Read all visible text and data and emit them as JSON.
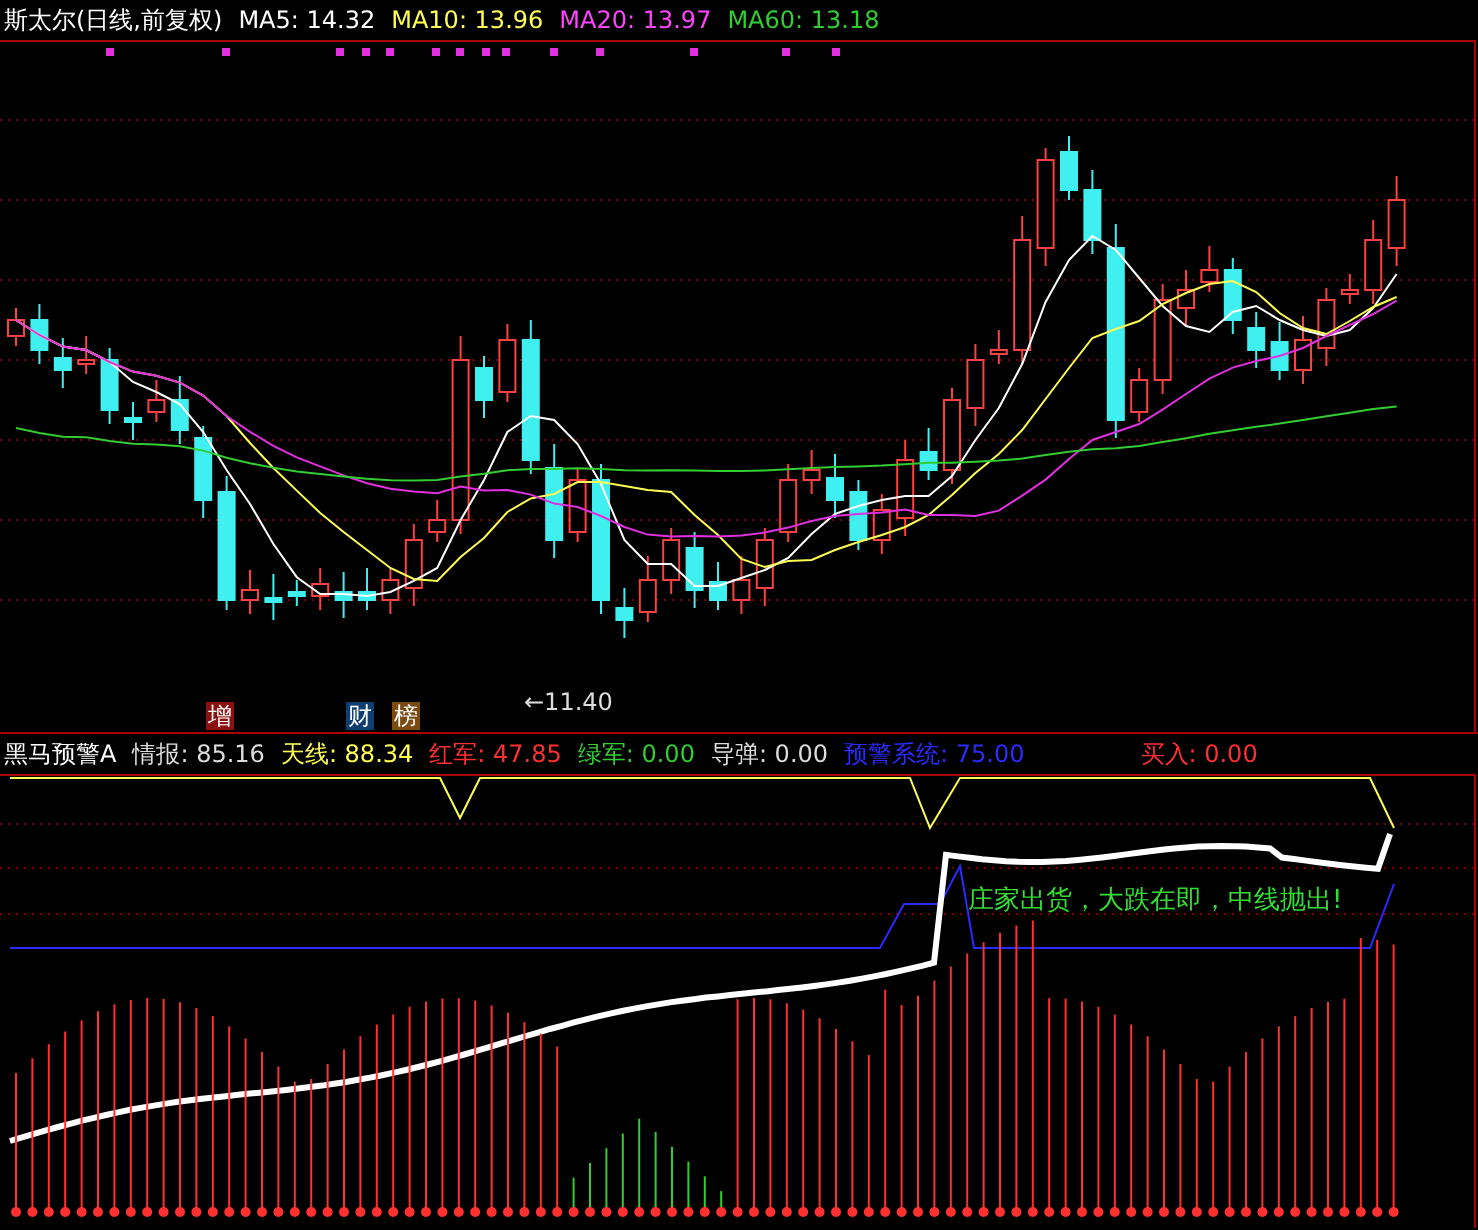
{
  "price_panel": {
    "title": "斯太尔(日线,前复权)",
    "moving_averages": [
      {
        "label": "MA5: 14.32",
        "color": "#ffffff"
      },
      {
        "label": "MA10: 13.96",
        "color": "#ffff54"
      },
      {
        "label": "MA20: 13.97",
        "color": "#ff44ff"
      },
      {
        "label": "MA60: 13.18",
        "color": "#33cc33"
      }
    ],
    "low_marker": "←11.40",
    "tags": [
      {
        "text": "增",
        "color": "#8b1010"
      },
      {
        "text": "财",
        "color": "#103e70"
      },
      {
        "text": "榜",
        "color": "#7a4a10"
      }
    ]
  },
  "indicator_panel": {
    "name": "黑马预警A",
    "readings": [
      {
        "label": "情报: 85.16",
        "color": "#dddddd"
      },
      {
        "label": "天线: 88.34",
        "color": "#ffff54"
      },
      {
        "label": "红军: 47.85",
        "color": "#ff3030"
      },
      {
        "label": "绿军: 0.00",
        "color": "#33cc33"
      },
      {
        "label": "导弹: 0.00",
        "color": "#dddddd"
      },
      {
        "label": "预警系统: 75.00",
        "color": "#2a2aff"
      },
      {
        "label": "买入: 0.00",
        "color": "#ff3030"
      }
    ],
    "signal_text": "庄家出货，大跌在即，中线抛出!"
  }
}
